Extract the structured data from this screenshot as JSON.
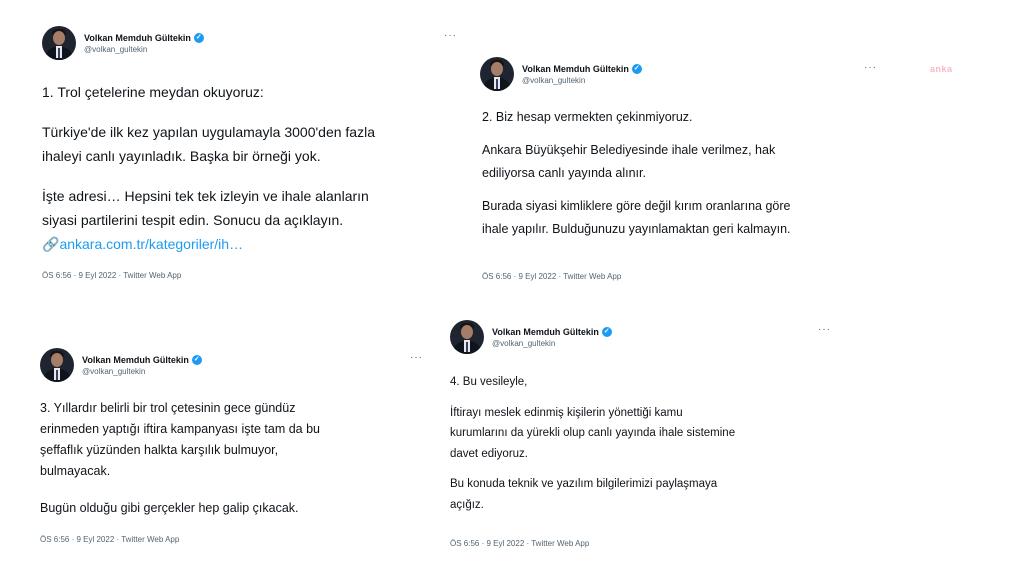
{
  "author": {
    "name": "Volkan Memduh Gültekin",
    "handle": "@volkan_gultekin",
    "verified_mark": "✓",
    "more_icon": "···"
  },
  "watermark": "anka",
  "tweets": [
    {
      "lines": [
        "1. Trol çetelerine meydan okuyoruz:",
        "Türkiye'de ilk kez yapılan uygulamayla 3000'den fazla",
        "ihaleyi canlı yayınladık. Başka bir örneği yok.",
        "İşte adresi… Hepsini tek tek izleyin ve ihale alanların",
        "siyasi partilerini tespit edin. Sonucu da açıklayın."
      ],
      "link_icon": "🔗",
      "link": "ankara.com.tr/kategoriler/ih…",
      "meta": "ÖS 6:56 · 9 Eyl 2022 · Twitter Web App"
    },
    {
      "lines": [
        "2. Biz hesap vermekten çekinmiyoruz.",
        "Ankara Büyükşehir Belediyesinde ihale verilmez, hak",
        "ediliyorsa canlı yayında alınır.",
        "Burada siyasi kimliklere göre değil kırım oranlarına göre",
        "ihale yapılır. Bulduğunuzu yayınlamaktan geri kalmayın."
      ],
      "meta": "ÖS 6:56 · 9 Eyl 2022 · Twitter Web App"
    },
    {
      "lines": [
        "3. Yıllardır belirli bir trol çetesinin gece gündüz",
        "erinmeden yaptığı iftira kampanyası işte tam da bu",
        "şeffaflık yüzünden halkta karşılık bulmuyor,",
        "bulmayacak.",
        "Bugün olduğu gibi gerçekler hep galip çıkacak."
      ],
      "meta": "ÖS 6:56 · 9 Eyl 2022 · Twitter Web App"
    },
    {
      "lines": [
        "4. Bu vesileyle,",
        "İftirayı meslek edinmiş kişilerin yönettiği kamu",
        "kurumlarını da yürekli olup canlı yayında ihale sistemine",
        "davet ediyoruz.",
        "Bu konuda teknik ve yazılım bilgilerimizi paylaşmaya",
        "açığız."
      ],
      "meta": "ÖS 6:56 · 9 Eyl 2022 · Twitter Web App"
    }
  ]
}
